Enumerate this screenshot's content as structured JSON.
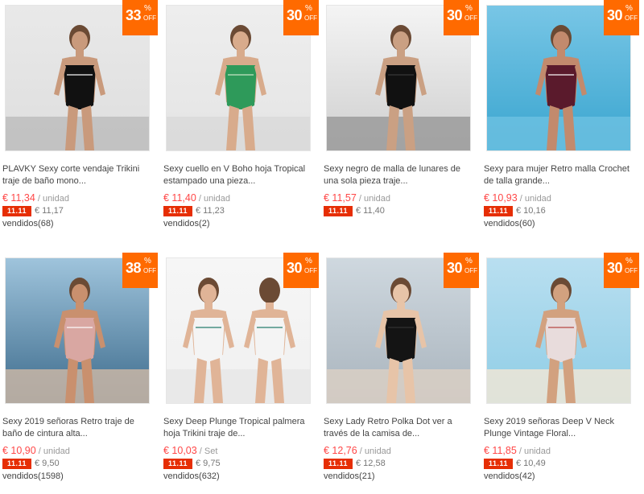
{
  "colors": {
    "badge": "#ff6a00",
    "price": "#ff4747",
    "promo_tag": "#e62e04"
  },
  "products": [
    {
      "discount": "33",
      "discount_symbol": "%",
      "discount_off": "OFF",
      "title": "PLAVKY Sexy corte vendaje Trikini traje de baño mono...",
      "price": "€ 11,34",
      "unit": " / unidad",
      "promo_tag": "11.11",
      "promo_price": "€ 11,17",
      "sold": "vendidos(68)",
      "image": "black two-piece cutout swimsuit",
      "watermark": "PLAVKY"
    },
    {
      "discount": "30",
      "discount_symbol": "%",
      "discount_off": "OFF",
      "title": "Sexy cuello en V Boho hoja Tropical estampado una pieza...",
      "price": "€ 11,40",
      "unit": " / unidad",
      "promo_tag": "11.11",
      "promo_price": "€ 11,23",
      "sold": "vendidos(2)",
      "image": "green tropical leaf one-piece swimsuit"
    },
    {
      "discount": "30",
      "discount_symbol": "%",
      "discount_off": "OFF",
      "title": "Sexy negro de malla de lunares de una sola pieza traje...",
      "price": "€ 11,57",
      "unit": " / unidad",
      "promo_tag": "11.11",
      "promo_price": "€ 11,40",
      "sold": "",
      "image": "black mesh polka dot one-piece swimsuit"
    },
    {
      "discount": "30",
      "discount_symbol": "%",
      "discount_off": "OFF",
      "title": "Sexy para mujer Retro malla Crochet de talla grande...",
      "price": "€ 10,93",
      "unit": " / unidad",
      "promo_tag": "11.11",
      "promo_price": "€ 10,16",
      "sold": "vendidos(60)",
      "image": "burgundy crochet one-piece by the sea",
      "watermark": "PLAVKY"
    },
    {
      "discount": "38",
      "discount_symbol": "%",
      "discount_off": "OFF",
      "title": "Sexy 2019 señoras Retro traje de baño de cintura alta...",
      "price": "€ 10,90",
      "unit": " / unidad",
      "promo_tag": "11.11",
      "promo_price": "€ 9,50",
      "sold": "vendidos(1598)",
      "image": "pink polka dot high waist bikini on boat"
    },
    {
      "discount": "30",
      "discount_symbol": "%",
      "discount_off": "OFF",
      "title": "Sexy Deep Plunge Tropical palmera hoja Trikini traje de...",
      "price": "€ 10,03",
      "unit": " / Set",
      "promo_tag": "11.11",
      "promo_price": "€ 9,75",
      "sold": "vendidos(632)",
      "image": "white and green palm print plunge swimsuit, front and back"
    },
    {
      "discount": "30",
      "discount_symbol": "%",
      "discount_off": "OFF",
      "title": "Sexy Lady Retro Polka Dot ver a través de la camisa de...",
      "price": "€ 12,76",
      "unit": " / unidad",
      "promo_tag": "11.11",
      "promo_price": "€ 12,58",
      "sold": "vendidos(21)",
      "image": "black sheer long sleeve bodysuit"
    },
    {
      "discount": "30",
      "discount_symbol": "%",
      "discount_off": "OFF",
      "title": "Sexy 2019 señoras Deep V Neck Plunge Vintage Floral...",
      "price": "€ 11,85",
      "unit": " / unidad",
      "promo_tag": "11.11",
      "promo_price": "€ 10,49",
      "sold": "vendidos(42)",
      "image": "floral deep v swimsuit on beach"
    }
  ]
}
